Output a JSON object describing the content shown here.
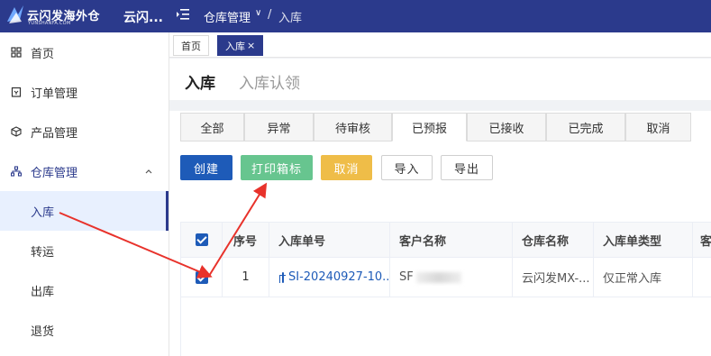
{
  "topbar": {
    "logo_title": "云闪发海外仓",
    "logo_sub": "YUNSHANFA.COM",
    "app_name": "云闪...",
    "breadcrumb_parent": "仓库管理",
    "breadcrumb_current": "入库",
    "breadcrumb_sep": "/",
    "arrow_glyph": "∨"
  },
  "sidebar": {
    "items": [
      {
        "label": "首页",
        "icon": "grid-icon"
      },
      {
        "label": "订单管理",
        "icon": "order-icon"
      },
      {
        "label": "产品管理",
        "icon": "cube-icon"
      },
      {
        "label": "仓库管理",
        "icon": "warehouse-icon"
      },
      {
        "label": "入库"
      },
      {
        "label": "转运"
      },
      {
        "label": "出库"
      },
      {
        "label": "退货"
      }
    ],
    "active_item": "入库"
  },
  "page_tabs": [
    {
      "label": "首页"
    },
    {
      "label": "入库",
      "close": "×"
    }
  ],
  "header": {
    "title": "入库",
    "subtitle": "入库认领"
  },
  "status_tabs": [
    "全部",
    "异常",
    "待审核",
    "已预报",
    "已接收",
    "已完成",
    "取消"
  ],
  "active_status_tab": "已预报",
  "toolbar": {
    "create": "创建",
    "print_label": "打印箱标",
    "cancel": "取消",
    "import": "导入",
    "export": "导出"
  },
  "table": {
    "columns": [
      "序号",
      "入库单号",
      "客户名称",
      "仓库名称",
      "入库单类型",
      "客"
    ],
    "rows": [
      {
        "index": "1",
        "order_no": "SI-20240927-10...",
        "customer": "SF",
        "warehouse": "云闪发MX-...",
        "type": "仅正常入库"
      }
    ]
  },
  "colors": {
    "brand": "#2b3a8c",
    "primary": "#1e5bb8",
    "green": "#67c58f",
    "yellow": "#efbd48",
    "annotation": "#e8322b"
  }
}
